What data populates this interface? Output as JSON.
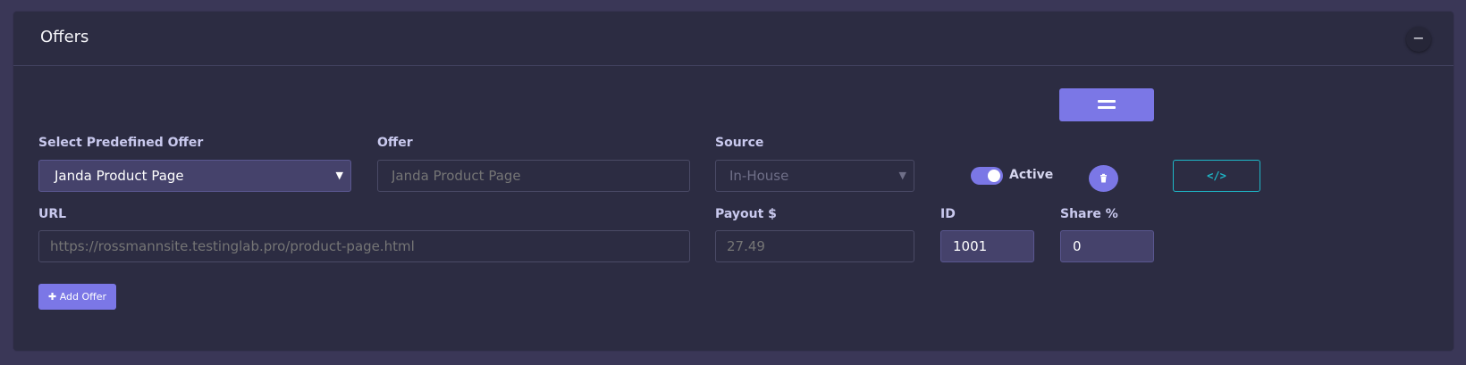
{
  "panel": {
    "title": "Offers",
    "collapse_icon": "minus-icon",
    "collapse_glyph": "−"
  },
  "form": {
    "predefined": {
      "label": "Select Predefined Offer",
      "value": "Janda Product Page"
    },
    "offer": {
      "label": "Offer",
      "placeholder": "Janda Product Page"
    },
    "source": {
      "label": "Source",
      "value": "In-House"
    },
    "active": {
      "label": "Active",
      "checked": true
    },
    "url": {
      "label": "URL",
      "placeholder": "https://rossmannsite.testinglab.pro/product-page.html"
    },
    "payout": {
      "label": "Payout $",
      "placeholder": "27.49"
    },
    "id": {
      "label": "ID",
      "value": "1001"
    },
    "share": {
      "label": "Share %",
      "value": "0"
    }
  },
  "buttons": {
    "code_glyph": "</>",
    "add_offer_icon": "✚",
    "add_offer_label": "Add Offer"
  },
  "icons": {
    "drag": "drag-handle-icon",
    "delete": "trash-icon",
    "code": "code-icon",
    "caret": "chevron-down-icon"
  },
  "colors": {
    "accent": "#7b77e6",
    "info": "#1eb7c7",
    "panel_bg": "#2c2c42",
    "page_bg": "#3a3757"
  }
}
